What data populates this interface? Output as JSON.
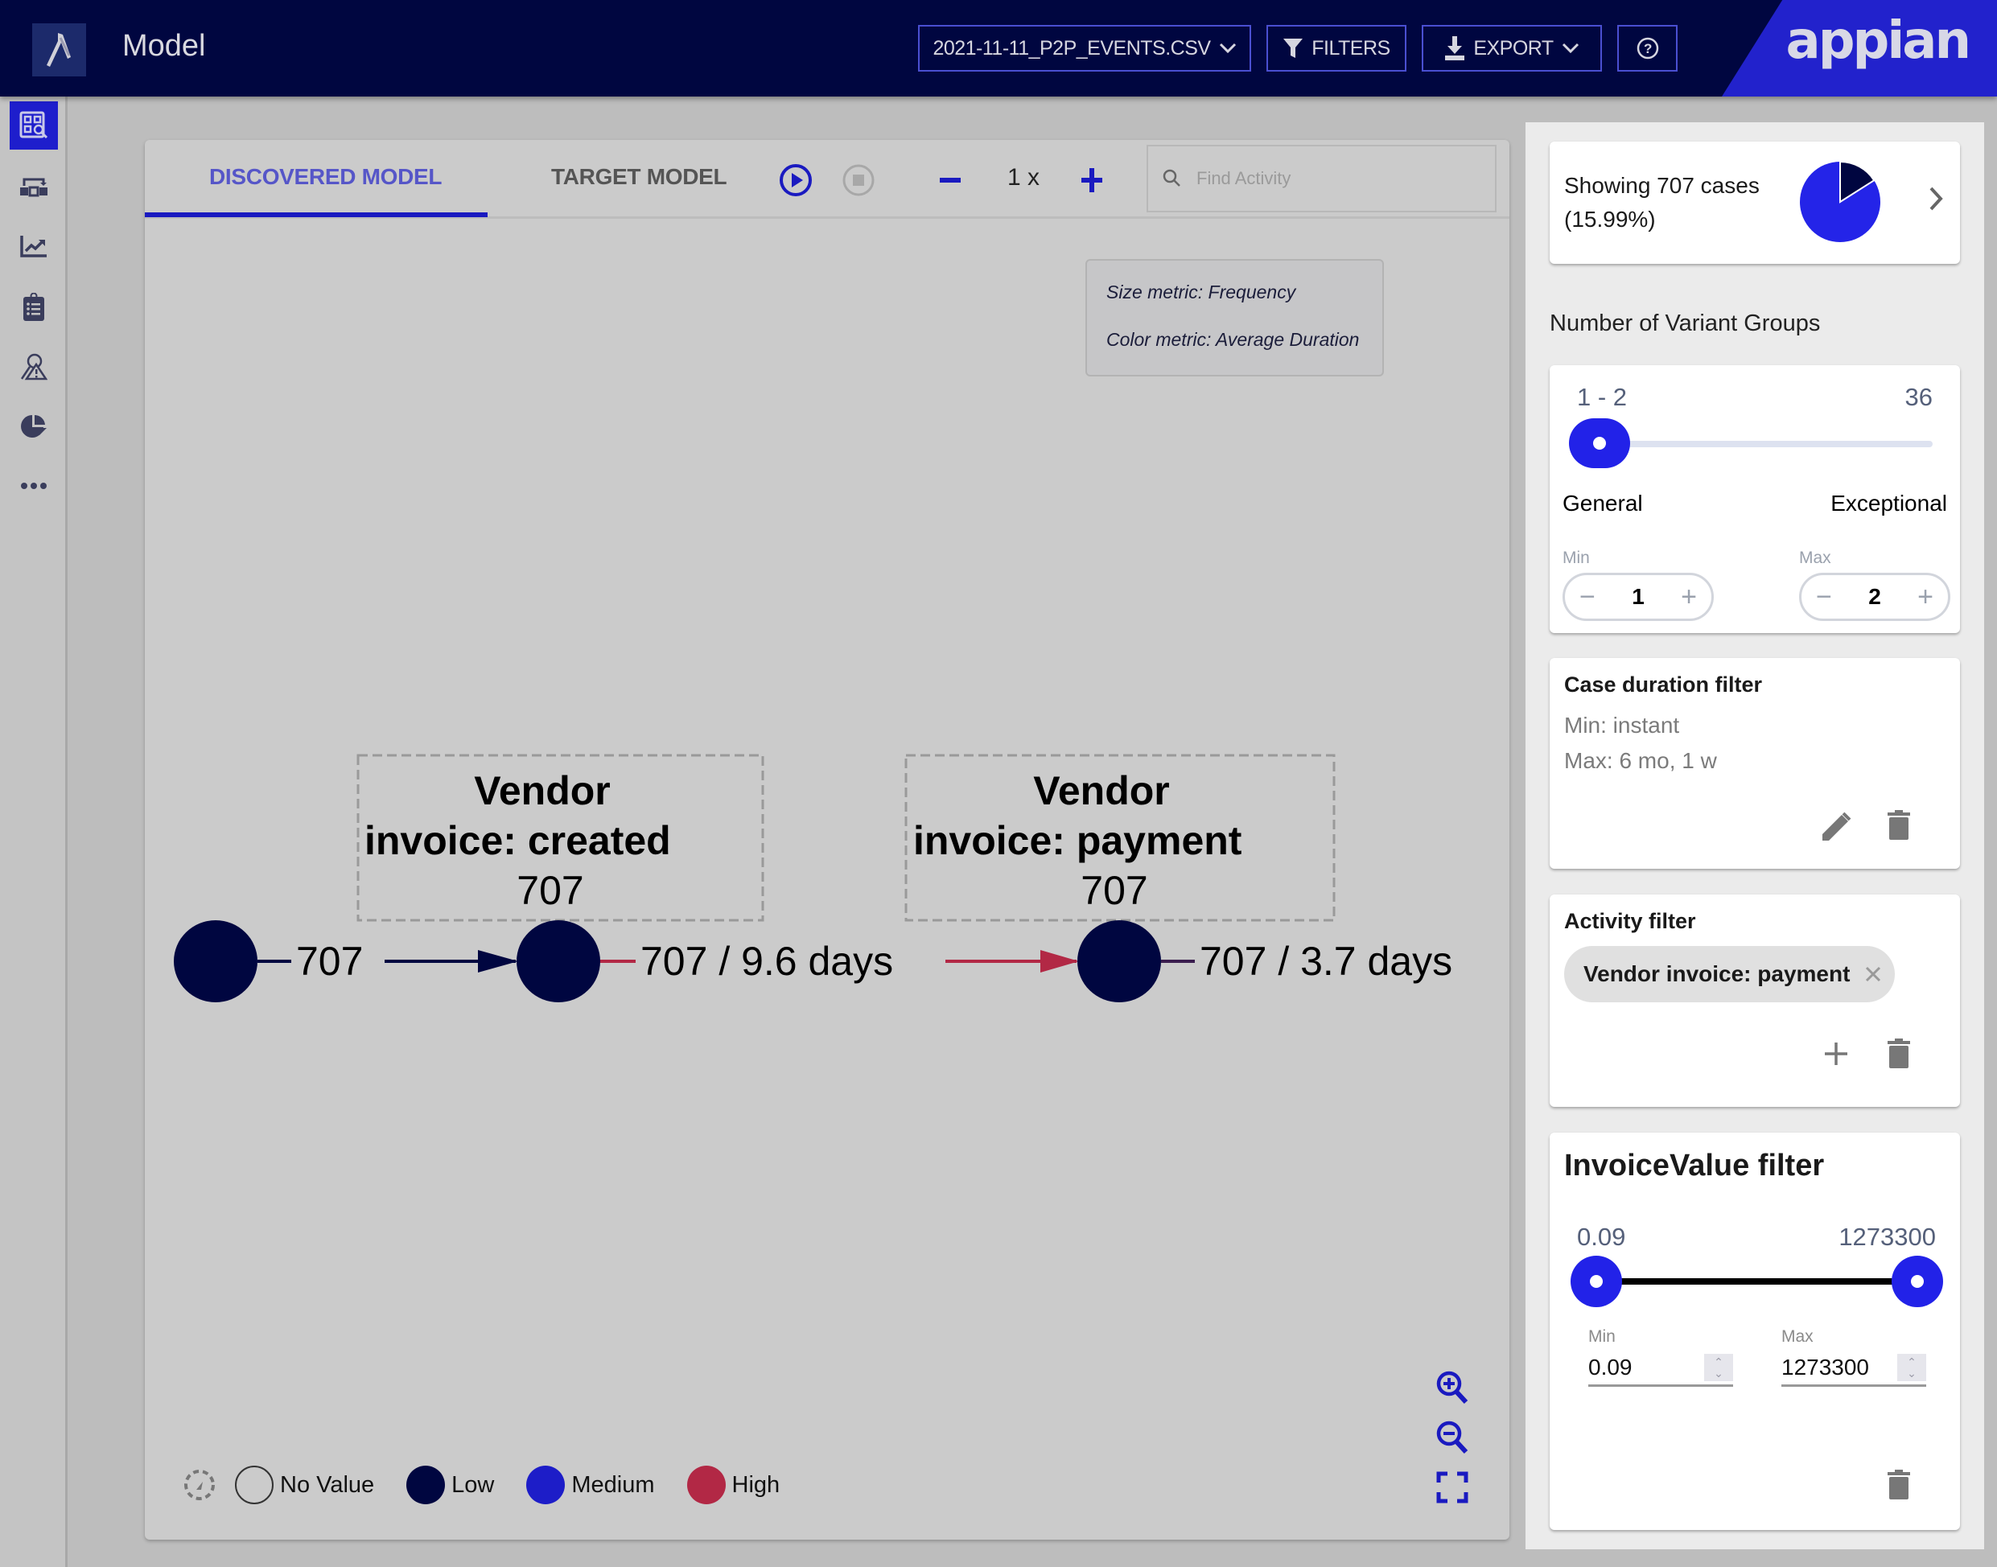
{
  "header": {
    "title": "Model",
    "file_select": "2021-11-11_P2P_EVENTS.CSV",
    "filters_label": "FILTERS",
    "export_label": "EXPORT",
    "brand": "appian"
  },
  "rail": {
    "items": [
      {
        "name": "discovery-model-icon",
        "active": true
      },
      {
        "name": "process-flow-icon",
        "active": false
      },
      {
        "name": "trend-chart-icon",
        "active": false
      },
      {
        "name": "clipboard-list-icon",
        "active": false
      },
      {
        "name": "risk-analysis-icon",
        "active": false
      },
      {
        "name": "pie-chart-icon",
        "active": false
      },
      {
        "name": "more-icon",
        "active": false
      }
    ]
  },
  "canvas": {
    "tabs": [
      {
        "label": "DISCOVERED MODEL",
        "active": true
      },
      {
        "label": "TARGET MODEL",
        "active": false
      }
    ],
    "zoom_level": "1 x",
    "search_placeholder": "Find Activity",
    "metrics": {
      "size": "Size metric: Frequency",
      "color": "Color metric: Average Duration"
    },
    "graph": {
      "nodes": [
        {
          "id": "start",
          "label": "",
          "count": ""
        },
        {
          "id": "created",
          "label_line1": "Vendor",
          "label_line2": "invoice: created",
          "count": "707"
        },
        {
          "id": "payment",
          "label_line1": "Vendor",
          "label_line2": "invoice: payment",
          "count": "707"
        }
      ],
      "edges": [
        {
          "from": "start",
          "to": "created",
          "label": "707",
          "level": "Low"
        },
        {
          "from": "created",
          "to": "payment",
          "label": "707 / 9.6 days",
          "level": "High"
        },
        {
          "from": "payment",
          "to": "end",
          "label": "707 / 3.7 days",
          "level": "Low"
        }
      ]
    },
    "legend": [
      {
        "label": "No Value",
        "color": "none"
      },
      {
        "label": "Low",
        "color": "#000640"
      },
      {
        "label": "Medium",
        "color": "#1d1dc8"
      },
      {
        "label": "High",
        "color": "#b22845"
      }
    ]
  },
  "panel": {
    "cases": {
      "line1": "Showing 707 cases",
      "line2": "(15.99%)",
      "fraction": 0.1599,
      "colors": {
        "shown": "#000640",
        "rest": "#2424e8"
      }
    },
    "variant_groups": {
      "title": "Number of Variant Groups",
      "range_label": "1 - 2",
      "max_label": "36",
      "left_label": "General",
      "right_label": "Exceptional",
      "min_caption": "Min",
      "max_caption": "Max",
      "min_value": "1",
      "max_value": "2"
    },
    "case_duration": {
      "title": "Case duration filter",
      "min": "Min: instant",
      "max": "Max: 6 mo, 1 w"
    },
    "activity_filter": {
      "title": "Activity filter",
      "chip": "Vendor invoice: payment"
    },
    "invoice_value": {
      "title": "InvoiceValue filter",
      "low_label": "0.09",
      "high_label": "1273300",
      "min_caption": "Min",
      "max_caption": "Max",
      "min_value": "0.09",
      "max_value": "1273300"
    }
  }
}
